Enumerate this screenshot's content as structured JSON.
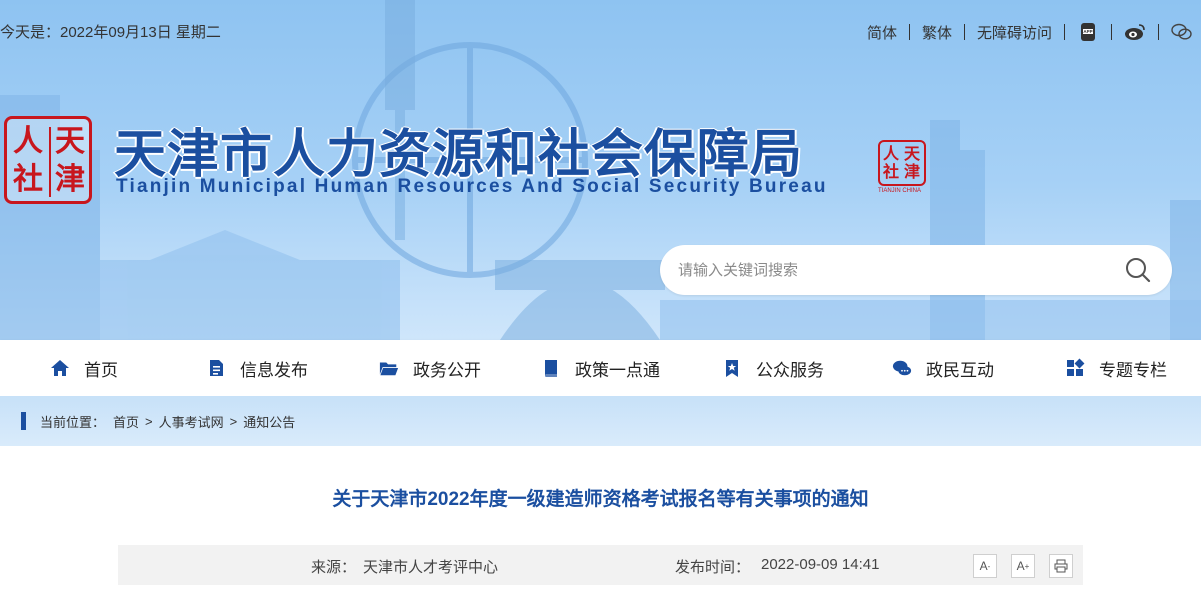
{
  "topbar": {
    "date_text": "今天是：2022年09月13日 星期二",
    "links": [
      "简体",
      "繁体",
      "无障碍访问"
    ],
    "icons": [
      "app-icon",
      "weibo-icon",
      "wechat-icon"
    ]
  },
  "logo": {
    "seal_chars": [
      "人",
      "天",
      "社",
      "津"
    ],
    "title": "天津市人力资源和社会保障局",
    "subtitle": "Tianjin Municipal Human Resources And Social Security Bureau",
    "stamp_chars": [
      "天",
      "津",
      "人",
      "社"
    ],
    "stamp_caption": "TIANJIN CHINA"
  },
  "search": {
    "placeholder": "请输入关键词搜索"
  },
  "nav": {
    "items": [
      {
        "label": "首页",
        "icon": "home-icon"
      },
      {
        "label": "信息发布",
        "icon": "document-icon"
      },
      {
        "label": "政务公开",
        "icon": "folder-icon"
      },
      {
        "label": "政策一点通",
        "icon": "book-icon"
      },
      {
        "label": "公众服务",
        "icon": "bookmark-star-icon"
      },
      {
        "label": "政民互动",
        "icon": "chat-icon"
      },
      {
        "label": "专题专栏",
        "icon": "grid-icon"
      }
    ]
  },
  "breadcrumb": {
    "prefix": "当前位置：",
    "items": [
      "首页",
      "人事考试网",
      "通知公告"
    ],
    "separator": ">"
  },
  "article": {
    "title": "关于天津市2022年度一级建造师资格考试报名等有关事项的通知",
    "source_label": "来源：",
    "source_value": "天津市人才考评中心",
    "date_label": "发布时间：",
    "date_value": "2022-09-09 14:41",
    "font_smaller": "A",
    "font_smaller_mark": "-",
    "font_larger": "A",
    "font_larger_mark": "+"
  },
  "colors": {
    "brand_blue": "#1b4fa0",
    "seal_red": "#c8161d",
    "banner_sky": "#8ec3f1",
    "crumb_bg": "#c7e1f8"
  }
}
